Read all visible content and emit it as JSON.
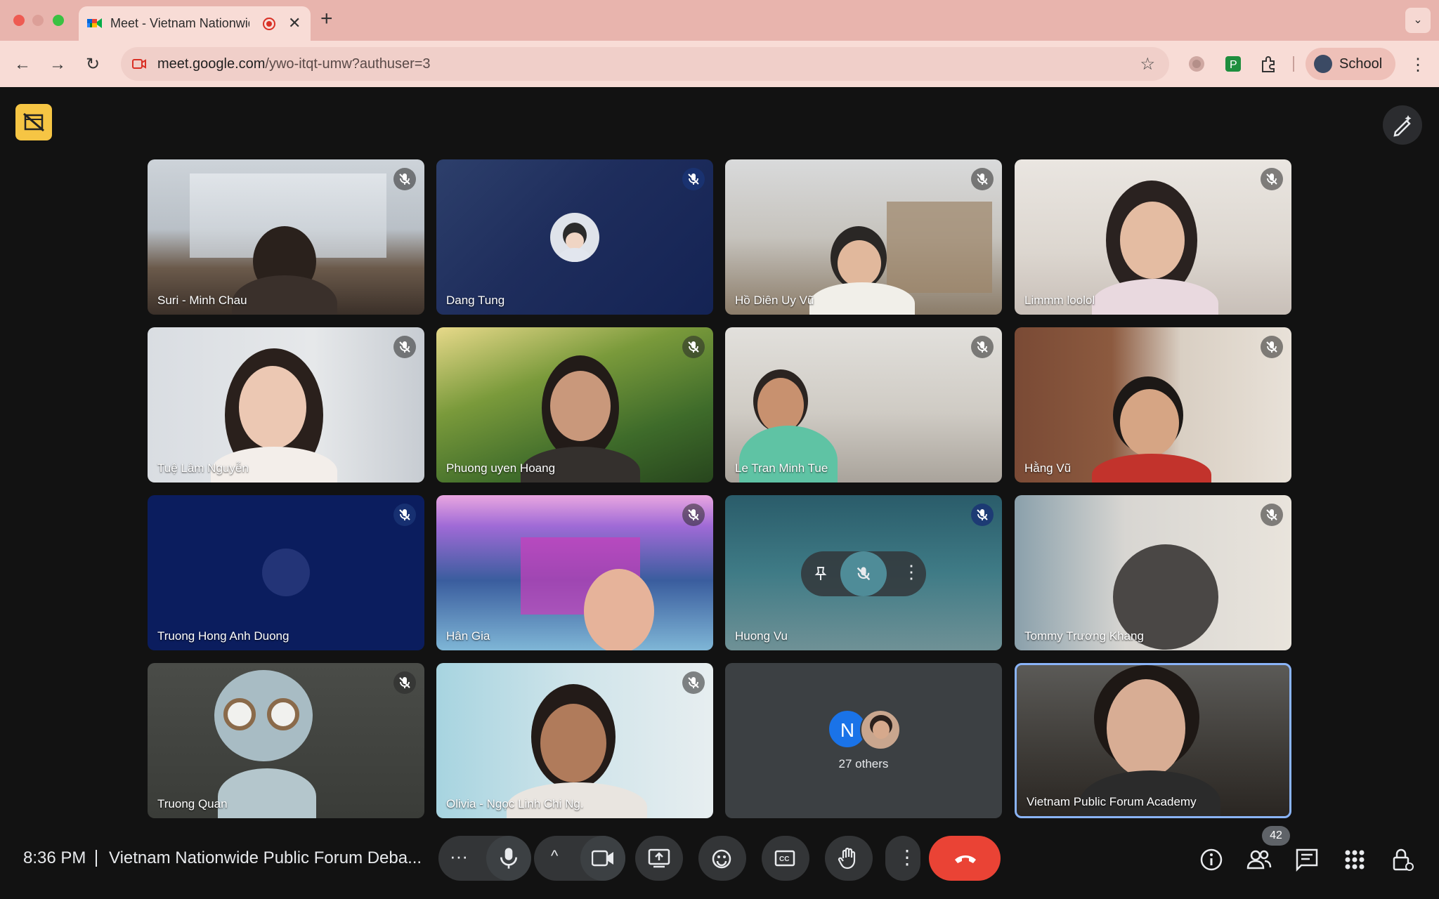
{
  "browser": {
    "tab_title": "Meet - Vietnam Nationwide Public Forum Debate",
    "url_host": "meet.google.com",
    "url_path": "/ywo-itqt-umw?authuser=3",
    "profile_label": "School"
  },
  "meet": {
    "tiles": [
      {
        "name": "Suri - Minh Chau",
        "muted": true
      },
      {
        "name": "Dang Tung",
        "muted": true
      },
      {
        "name": "Hồ Diên Uy Vũ",
        "muted": true
      },
      {
        "name": "Limmm loolol",
        "muted": true
      },
      {
        "name": "Tuệ Lâm Nguyễn",
        "muted": true
      },
      {
        "name": "Phuong uyen Hoang",
        "muted": true
      },
      {
        "name": "Le Tran Minh Tue",
        "muted": true
      },
      {
        "name": "Hằng Vũ",
        "muted": true
      },
      {
        "name": "Truong Hong Anh Duong",
        "muted": true
      },
      {
        "name": "Hân Gia",
        "muted": true
      },
      {
        "name": "Huong Vu",
        "muted": true
      },
      {
        "name": "Tommy Trương Khang",
        "muted": true
      },
      {
        "name": "Truong Quan",
        "muted": true
      },
      {
        "name": "Olivia - Ngọc Linh Chi Ng.",
        "muted": true
      },
      {
        "name": "Vietnam Public Forum Academy",
        "muted": false
      }
    ],
    "others": {
      "initial": "N",
      "label": "27 others"
    },
    "bottom_bar": {
      "time": "8:36 PM",
      "meeting_title": "Vietnam Nationwide Public Forum Deba...",
      "participant_count": "42"
    },
    "colors": {
      "end_call": "#ea4335",
      "active_border": "#8ab4f8",
      "accent_yellow": "#f6c544"
    }
  }
}
